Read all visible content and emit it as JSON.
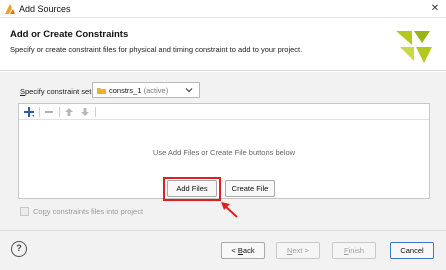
{
  "window": {
    "title": "Add Sources",
    "close_glyph": "✕"
  },
  "header": {
    "title": "Add or Create Constraints",
    "subtitle": "Specify or create constraint files for physical and timing constraint to add to your project."
  },
  "constraint_set": {
    "label_first": "S",
    "label_rest": "pecify constraint set:",
    "value": "constrs_1",
    "value_suffix": "(active)"
  },
  "toolbar": {
    "add_icon": "plus-icon",
    "remove_icon": "minus-icon",
    "up_icon": "arrow-up-icon",
    "down_icon": "arrow-down-icon"
  },
  "files_panel": {
    "empty_hint": "Use Add Files or Create File buttons below"
  },
  "actions": {
    "add_files": "Add Files",
    "create_file": "Create File"
  },
  "copy_option": {
    "label_before": "Co",
    "label_u": "p",
    "label_after": "y constraints files into project",
    "checked": false
  },
  "footer": {
    "help": "?",
    "back_pre": "< ",
    "back_u": "B",
    "back_post": "ack",
    "next_u": "N",
    "next_post": "ext >",
    "finish_u": "F",
    "finish_post": "inish",
    "cancel": "Cancel"
  },
  "colors": {
    "highlight": "#e02020",
    "logo": "#b5c81e"
  }
}
